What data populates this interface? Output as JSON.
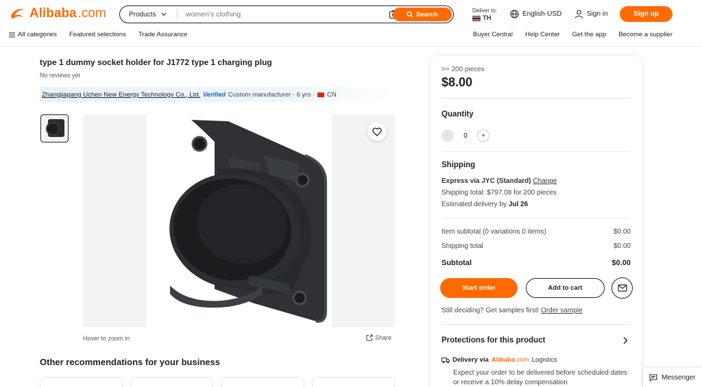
{
  "header": {
    "logo_text": "Alibaba",
    "logo_suffix": ".com",
    "search": {
      "category": "Products",
      "placeholder": "women's clothing",
      "button_label": "Search"
    },
    "deliver_to": {
      "label": "Deliver to:",
      "country": "TH"
    },
    "language_currency": "English-USD",
    "sign_in": "Sign in",
    "sign_up": "Sign up",
    "nav_left": [
      "All categories",
      "Featured selections",
      "Trade Assurance"
    ],
    "nav_right": [
      "Buyer Central",
      "Help Center",
      "Get the app",
      "Become a supplier"
    ]
  },
  "product": {
    "title": "type 1 dummy socket holder for J1772 type 1 charging plug",
    "reviews": "No reviews yet",
    "supplier": {
      "name": "Zhangjiagang Uchen New Energy Technology Co., Ltd.",
      "verified": "Verified",
      "details": "Custom manufacturer · 6 yrs ·",
      "country": "CN"
    },
    "hover_hint": "Hover to zoom in",
    "share": "Share"
  },
  "recommendations": {
    "title": "Other recommendations for your business"
  },
  "order_panel": {
    "moq": ">= 200 pieces",
    "price": "$8.00",
    "quantity_label": "Quantity",
    "quantity_value": "0",
    "minus": "-",
    "plus": "+",
    "shipping_label": "Shipping",
    "ship_method": "Express via JYC (Standard)",
    "ship_change": "Change",
    "ship_total": "Shipping total: $797.08 for 200 pieces",
    "eta_prefix": "Estimated delivery by",
    "eta_date": "Jul 26",
    "item_subtotal_label": "Item subtotal (0 variations 0 items)",
    "item_subtotal_value": "$0.00",
    "shipping_total_label": "Shipping total",
    "shipping_total_value": "$0.00",
    "subtotal_label": "Subtotal",
    "subtotal_value": "$0.00",
    "start_order": "Start order",
    "add_to_cart": "Add to cart",
    "deciding_text": "Still deciding? Get samples first!",
    "order_sample": "Order sample",
    "protections_title": "Protections for this product",
    "delivery_label": "Delivery via",
    "delivery_brand": "Alibaba",
    "delivery_brand_suffix": ".com",
    "delivery_logistics": "Logistics",
    "delivery_desc": "Expect your order to be delivered before scheduled dates or receive a 10% delay compensation"
  },
  "messenger": "Messenger",
  "colors": {
    "brand_orange": "#ff6a00",
    "verified_blue": "#1a5ccc"
  },
  "icons": [
    "alibaba-logo-icon",
    "chevron-down-icon",
    "camera-icon",
    "search-icon",
    "globe-icon",
    "user-icon",
    "menu-icon",
    "heart-icon",
    "share-icon",
    "mail-icon",
    "chevron-right-icon",
    "truck-icon",
    "chat-icon"
  ]
}
